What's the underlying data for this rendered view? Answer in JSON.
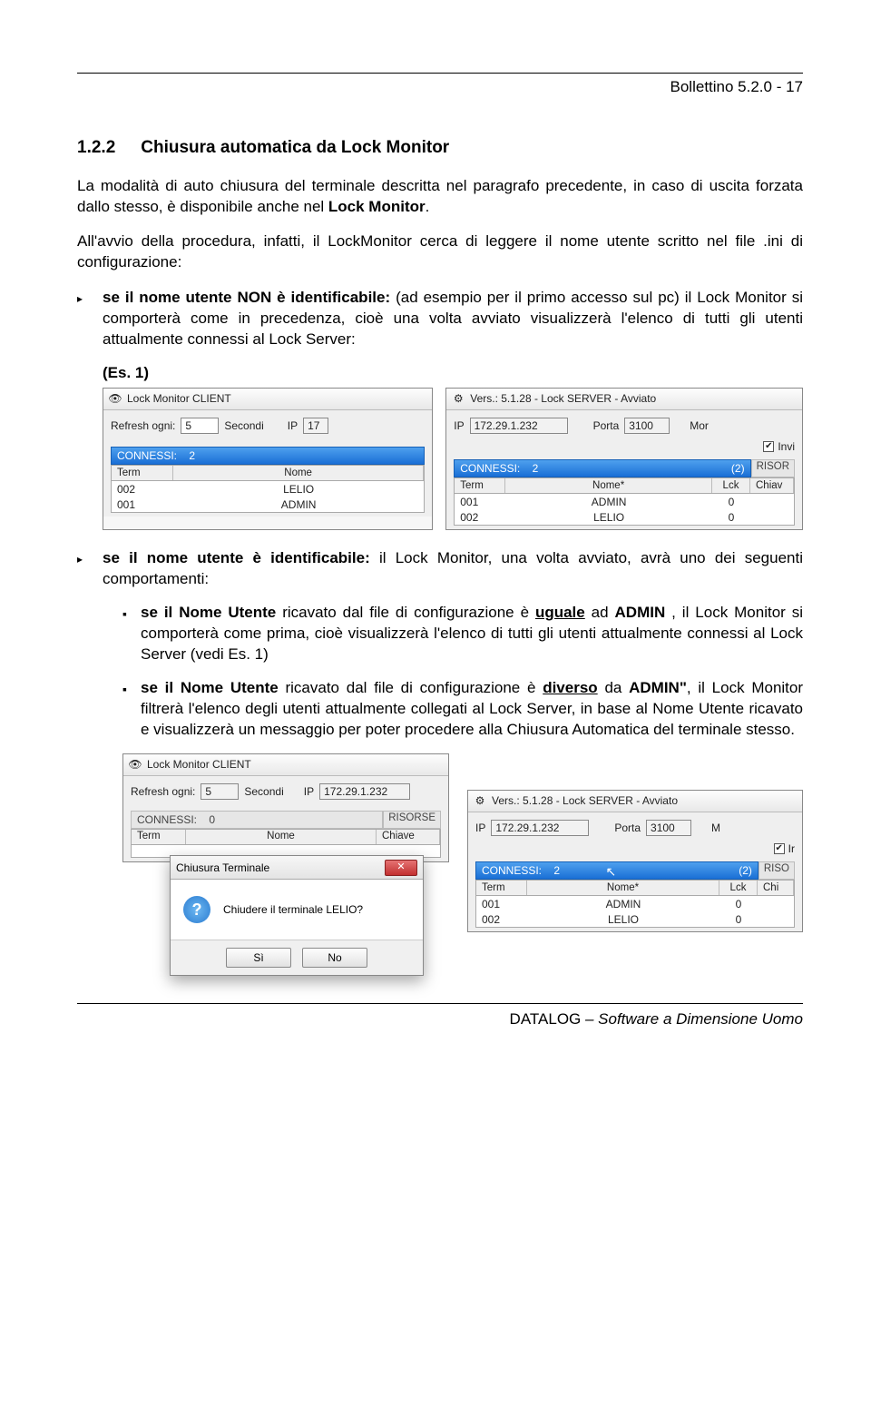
{
  "header": {
    "text": "Bollettino 5.2.0 - 17"
  },
  "section": {
    "num": "1.2.2",
    "title": "Chiusura automatica da Lock Monitor"
  },
  "para1_a": "La modalità di auto chiusura del terminale descritta nel paragrafo precedente, in caso di uscita forzata dallo stesso, è disponibile anche nel ",
  "para1_b": "Lock Monitor",
  "para1_c": ".",
  "para2": "All'avvio della procedura, infatti, il LockMonitor cerca di leggere il nome utente scritto nel file .ini di configurazione:",
  "bullet1_a": "se il nome utente NON è identificabile:",
  "bullet1_b": " (ad esempio per il primo accesso sul pc) il Lock Monitor si comporterà come in precedenza, cioè una volta avviato visualizzerà l'elenco di tutti gli utenti attualmente connessi al Lock Server:",
  "es1": "(Es. 1)",
  "client": {
    "title": "Lock Monitor CLIENT",
    "refresh_lbl": "Refresh ogni:",
    "refresh_val": "5",
    "secondi": "Secondi",
    "ip_lbl": "IP",
    "ip_val": "17",
    "connessi_lbl": "CONNESSI:",
    "connessi_val": "2",
    "col_term": "Term",
    "col_nome": "Nome",
    "rows": [
      {
        "term": "002",
        "nome": "LELIO"
      },
      {
        "term": "001",
        "nome": "ADMIN"
      }
    ]
  },
  "server": {
    "title": "Vers.: 5.1.28  -  Lock SERVER - Avviato",
    "ip_lbl": "IP",
    "ip_val": "172.29.1.232",
    "porta_lbl": "Porta",
    "porta_val": "3100",
    "mor": "Mor",
    "inv_chk": "Invi",
    "connessi_lbl": "CONNESSI:",
    "connessi_val": "2",
    "connessi_par": "(2)",
    "risor": "RISOR",
    "col_term": "Term",
    "col_nome": "Nome*",
    "col_lck": "Lck",
    "col_chiav": "Chiav",
    "rows": [
      {
        "term": "001",
        "nome": "ADMIN",
        "lck": "0"
      },
      {
        "term": "002",
        "nome": "LELIO",
        "lck": "0"
      }
    ]
  },
  "bullet2_a": "se il nome utente è identificabile:",
  "bullet2_b": " il Lock Monitor, una volta avviato, avrà uno dei seguenti comportamenti:",
  "sub1_a": "se il Nome Utente",
  "sub1_b": " ricavato dal file di configurazione è ",
  "sub1_c": "uguale",
  "sub1_d": " ad ",
  "sub1_e": "ADMIN",
  "sub1_f": " , il Lock Monitor si comporterà come prima, cioè visualizzerà l'elenco di tutti gli utenti attualmente connessi al Lock Server (vedi Es. 1)",
  "sub2_a": "se il Nome Utente",
  "sub2_b": " ricavato dal file di configurazione è ",
  "sub2_c": "diverso",
  "sub2_d": " da ",
  "sub2_e": "ADMIN\"",
  "sub2_f": ", il Lock Monitor filtrerà l'elenco degli utenti attualmente collegati al Lock Server, in base al Nome Utente ricavato e visualizzerà un messaggio per poter procedere alla Chiusura Automatica del terminale stesso.",
  "client2": {
    "title": "Lock Monitor CLIENT",
    "refresh_lbl": "Refresh ogni:",
    "refresh_val": "5",
    "secondi": "Secondi",
    "ip_lbl": "IP",
    "ip_val": "172.29.1.232",
    "connessi_lbl": "CONNESSI:",
    "connessi_val": "0",
    "risorse": "RISORSE",
    "col_term": "Term",
    "col_nome": "Nome",
    "col_chiave": "Chiave"
  },
  "dialog": {
    "title": "Chiusura Terminale",
    "msg": "Chiudere il terminale LELIO?",
    "yes": "Sì",
    "no": "No"
  },
  "server2": {
    "title": "Vers.: 5.1.28  -  Lock SERVER - Avviato",
    "ip_lbl": "IP",
    "ip_val": "172.29.1.232",
    "porta_lbl": "Porta",
    "porta_val": "3100",
    "m": "M",
    "ir": "Ir",
    "connessi_lbl": "CONNESSI:",
    "connessi_val": "2",
    "connessi_par": "(2)",
    "riso": "RISO",
    "col_term": "Term",
    "col_nome": "Nome*",
    "col_lck": "Lck",
    "col_chi": "Chi",
    "rows": [
      {
        "term": "001",
        "nome": "ADMIN",
        "lck": "0"
      },
      {
        "term": "002",
        "nome": "LELIO",
        "lck": "0"
      }
    ]
  },
  "footer": {
    "a": "DATALOG",
    "b": " – Software a Dimensione Uomo"
  }
}
